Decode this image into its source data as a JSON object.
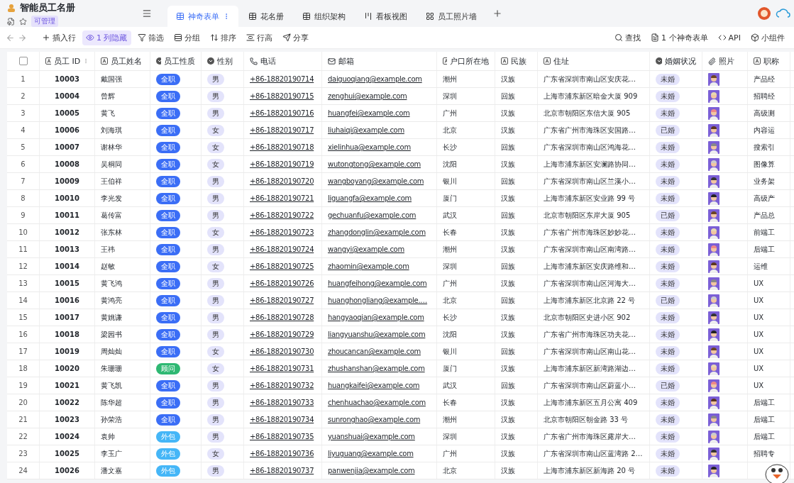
{
  "app": {
    "title": "智能员工名册",
    "permission": "可管理"
  },
  "tabs": [
    {
      "label": "神奇表单",
      "selected": true,
      "kind": "grid"
    },
    {
      "label": "花名册",
      "selected": false,
      "kind": "grid"
    },
    {
      "label": "组织架构",
      "selected": false,
      "kind": "grid"
    },
    {
      "label": "看板视图",
      "selected": false,
      "kind": "kanban"
    },
    {
      "label": "员工照片墙",
      "selected": false,
      "kind": "gallery"
    }
  ],
  "toolbar": {
    "left": [
      {
        "label": "插入行",
        "kind": "plus",
        "active": false
      },
      {
        "label": "1 列隐藏",
        "kind": "eye",
        "active": true
      },
      {
        "label": "筛选",
        "kind": "filter",
        "active": false
      },
      {
        "label": "分组",
        "kind": "group",
        "active": false
      },
      {
        "label": "排序",
        "kind": "sort",
        "active": false
      },
      {
        "label": "行高",
        "kind": "height",
        "active": false
      },
      {
        "label": "分享",
        "kind": "share",
        "active": false
      }
    ],
    "right": [
      {
        "label": "查找",
        "kind": "search"
      },
      {
        "label": "1 个神奇表单",
        "kind": "form"
      },
      {
        "label": "API",
        "kind": "code"
      },
      {
        "label": "小组件",
        "kind": "widget"
      }
    ]
  },
  "select_all": {
    "checked": false
  },
  "columns": [
    {
      "label": "员工 ID",
      "kind": "text"
    },
    {
      "label": "员工姓名",
      "kind": "text"
    },
    {
      "label": "员工性质",
      "kind": "select"
    },
    {
      "label": "性别",
      "kind": "select"
    },
    {
      "label": "电话",
      "kind": "phone"
    },
    {
      "label": "邮箱",
      "kind": "email"
    },
    {
      "label": "户口所在地",
      "kind": "text"
    },
    {
      "label": "民族",
      "kind": "text"
    },
    {
      "label": "住址",
      "kind": "text"
    },
    {
      "label": "婚姻状况",
      "kind": "select"
    },
    {
      "label": "照片",
      "kind": "attachment"
    },
    {
      "label": "职称",
      "kind": "text"
    }
  ],
  "rows": [
    {
      "no": "1",
      "id": "10003",
      "name": "戴国强",
      "type": {
        "label": "全职",
        "color": "#3b6ef6"
      },
      "gender": "男",
      "phone": "+86-18820190714",
      "email": "daiguoqiang@example.com",
      "hukou": "潮州",
      "ethnic": "汉族",
      "address": "广东省深圳市南山区安庆花…",
      "marital": "未婚",
      "title": "产品经"
    },
    {
      "no": "2",
      "id": "10004",
      "name": "曾辉",
      "type": {
        "label": "全职",
        "color": "#3b6ef6"
      },
      "gender": "男",
      "phone": "+86-18820190715",
      "email": "zenghui@example.com",
      "hukou": "深圳",
      "ethnic": "回族",
      "address": "上海市浦东新区暗金大厦 909",
      "marital": "未婚",
      "title": "招聘经"
    },
    {
      "no": "3",
      "id": "10005",
      "name": "黄飞",
      "type": {
        "label": "全职",
        "color": "#3b6ef6"
      },
      "gender": "男",
      "phone": "+86-18820190716",
      "email": "huangfei@example.com",
      "hukou": "广州",
      "ethnic": "汉族",
      "address": "北京市朝阳区东信大厦 905",
      "marital": "未婚",
      "title": "高级测"
    },
    {
      "no": "4",
      "id": "10006",
      "name": "刘海琪",
      "type": {
        "label": "全职",
        "color": "#3b6ef6"
      },
      "gender": "女",
      "phone": "+86-18820190717",
      "email": "liuhaiqi@example.com",
      "hukou": "北京",
      "ethnic": "汉族",
      "address": "广东省广州市海珠区安国路…",
      "marital": "已婚",
      "title": "内容运"
    },
    {
      "no": "5",
      "id": "10007",
      "name": "谢林华",
      "type": {
        "label": "全职",
        "color": "#3b6ef6"
      },
      "gender": "女",
      "phone": "+86-18820190718",
      "email": "xielinhua@example.com",
      "hukou": "长沙",
      "ethnic": "回族",
      "address": "广东省深圳市南山区鸿海花…",
      "marital": "未婚",
      "title": "搜索引"
    },
    {
      "no": "6",
      "id": "10008",
      "name": "吴桐同",
      "type": {
        "label": "全职",
        "color": "#3b6ef6"
      },
      "gender": "女",
      "phone": "+86-18820190719",
      "email": "wutongtong@example.com",
      "hukou": "沈阳",
      "ethnic": "汉族",
      "address": "上海市浦东新区安澜路协同…",
      "marital": "未婚",
      "title": "图像算"
    },
    {
      "no": "7",
      "id": "10009",
      "name": "王伯祥",
      "type": {
        "label": "全职",
        "color": "#3b6ef6"
      },
      "gender": "男",
      "phone": "+86-18820190720",
      "email": "wangboyang@example.com",
      "hukou": "银川",
      "ethnic": "回族",
      "address": "广东省深圳市南山区兰溪小…",
      "marital": "未婚",
      "title": "业务架"
    },
    {
      "no": "8",
      "id": "10010",
      "name": "李光发",
      "type": {
        "label": "全职",
        "color": "#3b6ef6"
      },
      "gender": "男",
      "phone": "+86-18820190721",
      "email": "liguangfa@example.com",
      "hukou": "厦门",
      "ethnic": "汉族",
      "address": "上海市浦东新区安业路 99 号",
      "marital": "未婚",
      "title": "高级产"
    },
    {
      "no": "9",
      "id": "10011",
      "name": "葛传富",
      "type": {
        "label": "全职",
        "color": "#3b6ef6"
      },
      "gender": "男",
      "phone": "+86-18820190722",
      "email": "gechuanfu@example.com",
      "hukou": "武汉",
      "ethnic": "回族",
      "address": "北京市朝阳区东岸大厦 905",
      "marital": "已婚",
      "title": "产品总"
    },
    {
      "no": "10",
      "id": "10012",
      "name": "张东林",
      "type": {
        "label": "全职",
        "color": "#3b6ef6"
      },
      "gender": "女",
      "phone": "+86-18820190723",
      "email": "zhangdonglin@example.com",
      "hukou": "长春",
      "ethnic": "汉族",
      "address": "广东省广州市海珠区妙妙花…",
      "marital": "未婚",
      "title": "前端工"
    },
    {
      "no": "11",
      "id": "10013",
      "name": "王祎",
      "type": {
        "label": "全职",
        "color": "#3b6ef6"
      },
      "gender": "男",
      "phone": "+86-18820190724",
      "email": "wangyi@example.com",
      "hukou": "潮州",
      "ethnic": "汉族",
      "address": "广东省深圳市南山区南湾路…",
      "marital": "未婚",
      "title": "后端工"
    },
    {
      "no": "12",
      "id": "10014",
      "name": "赵敏",
      "type": {
        "label": "全职",
        "color": "#3b6ef6"
      },
      "gender": "女",
      "phone": "+86-18820190725",
      "email": "zhaomin@example.com",
      "hukou": "深圳",
      "ethnic": "回族",
      "address": "上海市浦东新区安庆路维和…",
      "marital": "未婚",
      "title": "运维"
    },
    {
      "no": "13",
      "id": "10015",
      "name": "黄飞鸿",
      "type": {
        "label": "全职",
        "color": "#3b6ef6"
      },
      "gender": "男",
      "phone": "+86-18820190726",
      "email": "huangfeihong@example.com",
      "hukou": "广州",
      "ethnic": "汉族",
      "address": "广东省深圳市南山区河海大…",
      "marital": "未婚",
      "title": "UX"
    },
    {
      "no": "14",
      "id": "10016",
      "name": "黄鸿亮",
      "type": {
        "label": "全职",
        "color": "#3b6ef6"
      },
      "gender": "男",
      "phone": "+86-18820190727",
      "email": "huanghongliang@example.…",
      "hukou": "北京",
      "ethnic": "回族",
      "address": "上海市浦东新区北京路 22 号",
      "marital": "已婚",
      "title": "UX"
    },
    {
      "no": "15",
      "id": "10017",
      "name": "黄姚谦",
      "type": {
        "label": "全职",
        "color": "#3b6ef6"
      },
      "gender": "男",
      "phone": "+86-18820190728",
      "email": "hangyaoqian@example.com",
      "hukou": "长沙",
      "ethnic": "汉族",
      "address": "北京市朝阳区史进小区 902",
      "marital": "未婚",
      "title": "UX"
    },
    {
      "no": "16",
      "id": "10018",
      "name": "梁园书",
      "type": {
        "label": "全职",
        "color": "#3b6ef6"
      },
      "gender": "男",
      "phone": "+86-18820190729",
      "email": "liangyuanshu@example.com",
      "hukou": "沈阳",
      "ethnic": "汉族",
      "address": "广东省广州市海珠区功夫花…",
      "marital": "未婚",
      "title": "UX"
    },
    {
      "no": "17",
      "id": "10019",
      "name": "周灿灿",
      "type": {
        "label": "全职",
        "color": "#3b6ef6"
      },
      "gender": "女",
      "phone": "+86-18820190730",
      "email": "zhoucancan@example.com",
      "hukou": "银川",
      "ethnic": "回族",
      "address": "广东省深圳市南山区南山花…",
      "marital": "未婚",
      "title": "UX"
    },
    {
      "no": "18",
      "id": "10020",
      "name": "朱珊珊",
      "type": {
        "label": "顾问",
        "color": "#2eb872"
      },
      "gender": "女",
      "phone": "+86-18820190731",
      "email": "zhushanshan@example.com",
      "hukou": "厦门",
      "ethnic": "汉族",
      "address": "上海市浦东新区新湾路湖边…",
      "marital": "未婚",
      "title": "UX"
    },
    {
      "no": "19",
      "id": "10021",
      "name": "黄飞凯",
      "type": {
        "label": "全职",
        "color": "#3b6ef6"
      },
      "gender": "男",
      "phone": "+86-18820190732",
      "email": "huangkaifei@example.com",
      "hukou": "武汉",
      "ethnic": "回族",
      "address": "广东省深圳市南山区蔚蓝小…",
      "marital": "已婚",
      "title": "UX"
    },
    {
      "no": "20",
      "id": "10022",
      "name": "陈华超",
      "type": {
        "label": "全职",
        "color": "#3b6ef6"
      },
      "gender": "男",
      "phone": "+86-18820190733",
      "email": "chenhuachao@example.com",
      "hukou": "长春",
      "ethnic": "汉族",
      "address": "上海市浦东新区五月公寓 409",
      "marital": "未婚",
      "title": "后端工"
    },
    {
      "no": "21",
      "id": "10023",
      "name": "孙荣浩",
      "type": {
        "label": "全职",
        "color": "#3b6ef6"
      },
      "gender": "男",
      "phone": "+86-18820190734",
      "email": "sunronghao@example.com",
      "hukou": "潮州",
      "ethnic": "汉族",
      "address": "北京市朝阳区朝金路 33 号",
      "marital": "未婚",
      "title": "后端工"
    },
    {
      "no": "22",
      "id": "10024",
      "name": "袁帅",
      "type": {
        "label": "外包",
        "color": "#45b6f7"
      },
      "gender": "男",
      "phone": "+86-18820190735",
      "email": "yuanshuai@example.com",
      "hukou": "深圳",
      "ethnic": "汉族",
      "address": "广东省广州市海珠区露岸大…",
      "marital": "未婚",
      "title": "后端工"
    },
    {
      "no": "23",
      "id": "10025",
      "name": "李玉广",
      "type": {
        "label": "外包",
        "color": "#45b6f7"
      },
      "gender": "女",
      "phone": "+86-18820190736",
      "email": "liyuguang@example.com",
      "hukou": "广州",
      "ethnic": "汉族",
      "address": "广东省深圳市南山区蓝湾路 2…",
      "marital": "未婚",
      "title": "招聘专"
    },
    {
      "no": "24",
      "id": "10026",
      "name": "潘文嘉",
      "type": {
        "label": "外包",
        "color": "#45b6f7"
      },
      "gender": "男",
      "phone": "+86-18820190737",
      "email": "panwenjia@example.com",
      "hukou": "北京",
      "ethnic": "汉族",
      "address": "上海市浦东新区新海路 20 号",
      "marital": "未婚"
    }
  ]
}
